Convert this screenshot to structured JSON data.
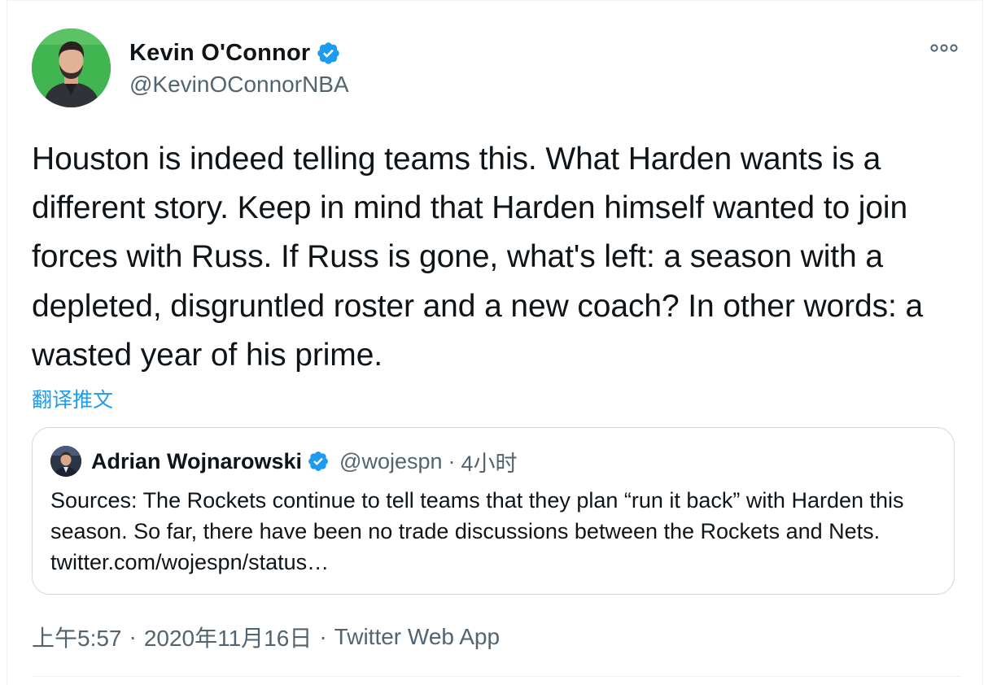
{
  "tweet": {
    "author": {
      "name": "Kevin O'Connor",
      "handle": "@KevinOConnorNBA",
      "verified": true
    },
    "more_icon": "more-horizontal-icon",
    "text": "Houston is indeed telling teams this. What Harden wants is a different story. Keep in mind that Harden himself wanted to join forces with Russ. If Russ is gone, what's left: a season with a depleted, disgruntled roster and a new coach? In other words: a wasted year of his prime.",
    "translate_label": "翻译推文",
    "quoted": {
      "author_name": "Adrian Wojnarowski",
      "handle": "@wojespn",
      "separator": "·",
      "time": "4小时",
      "verified": true,
      "text": "Sources: The Rockets continue to tell teams that they plan “run it back” with Harden this season. So far, there have been no trade discussions between the Rockets and Nets. twitter.com/wojespn/status…"
    },
    "meta": {
      "time": "上午5:57",
      "separator": "·",
      "date": "2020年11月16日",
      "separator2": "·",
      "app": "Twitter Web App"
    }
  },
  "colors": {
    "text_primary": "#0f1419",
    "text_secondary": "#536471",
    "accent": "#1d9bf0",
    "verified": "#1d9bf0",
    "border": "#cfd9de"
  }
}
